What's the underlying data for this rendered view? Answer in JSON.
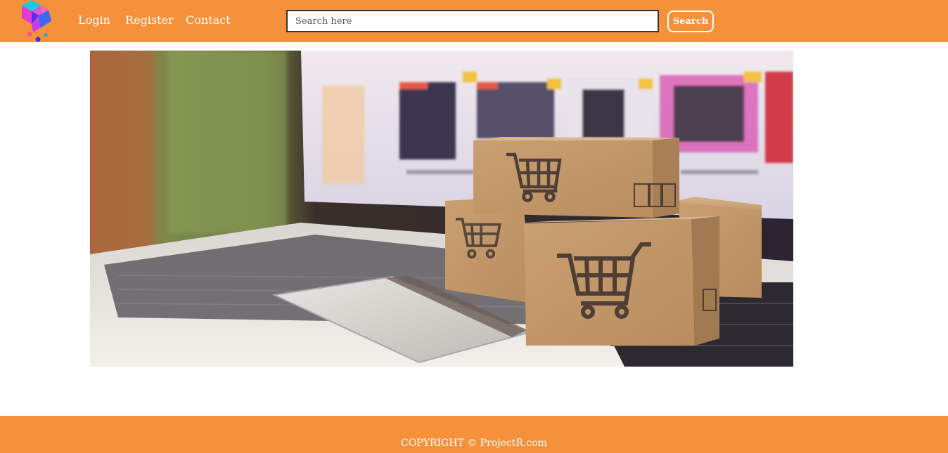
{
  "nav": {
    "links": [
      {
        "label": "Login"
      },
      {
        "label": "Register"
      },
      {
        "label": "Contact"
      }
    ]
  },
  "search": {
    "placeholder": "Search here",
    "value": "",
    "button_label": "Search"
  },
  "hero": {
    "image": "online-shopping-boxes-on-laptop"
  },
  "footer": {
    "copyright": "COPYRIGHT © ProjectR.com"
  },
  "colors": {
    "brand": "#f5913b",
    "text_on_brand": "#ffffff"
  }
}
